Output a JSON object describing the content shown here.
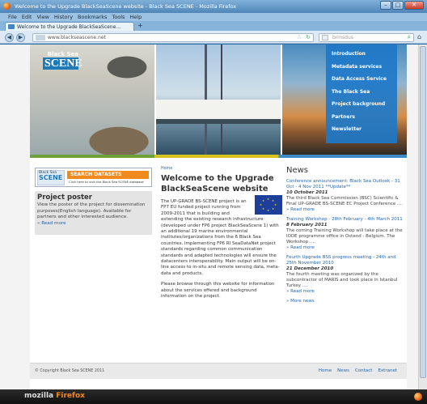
{
  "window": {
    "title": "Welcome to the Upgrade BlackSeaScene website - Black Sea SCENE - Mozilla Firefox",
    "controls": [
      "–",
      "□",
      "✕"
    ]
  },
  "menubar": [
    "File",
    "Edit",
    "View",
    "History",
    "Bookmarks",
    "Tools",
    "Help"
  ],
  "tab": {
    "label": "Welcome to the Upgrade BlackSeaScene...",
    "new_tab": "+"
  },
  "navbar": {
    "url": "www.blackseascene.net",
    "search_placeholder": "brmsdus"
  },
  "site": {
    "logo_top": "Black Sea",
    "logo_main": "SCENE",
    "menu": [
      "Introduction",
      "Metadata services",
      "Data Access Service",
      "The Black Sea",
      "Project background",
      "Partners",
      "Newsletter"
    ],
    "search_datasets": {
      "logo_top": "Black Sea",
      "logo_main": "SCENE",
      "button": "SEARCH DATASETS",
      "sub": "Click here to visit the Black Sea SCENE database"
    },
    "poster": {
      "title": "Project poster",
      "text": "View the poster of the project for dissemination purposes(English language). Available for partners and other interested audience.",
      "more": "» Read more"
    },
    "breadcrumb": "Home",
    "heading": "Welcome to the Upgrade BlackSeaScene website",
    "intro": "The UP-GRADE BS-SCENE project is an FP7 EU funded project running from 2009-2011 that is building and extending the existing research infrastructure (developed under FP6 project BlackSeaScene 1) with an additional 19 marine environmental institutes/organizations from the 6 Black Sea countries. Implementing FP6 RI SeaDataNet project standards regarding common communication standards and adapted technologies will ensure the datacenters interoperability. Main output will be on-line access to in-situ and remote sensing data, meta-data and products.",
    "browse": "Please browse through this website for information about the services offered and background information on the project.",
    "news_title": "News",
    "news": [
      {
        "title": "Conference announcement: Black Sea Outlook - 31 Oct - 4 Nov 2011 **Update**",
        "date": "10 October 2011",
        "body": "The third Black Sea Commission (BSC) Scientific & Final UP-GRADE BS-SCENE EC Project Conference ....",
        "more": "» Read more"
      },
      {
        "title": "Training Workshop - 28th February - 4th March 2011",
        "date": "8 February 2011",
        "body": "The coming Training Workshop will take place at the IODE programme office in Ostend - Belgium. The Workshop ....",
        "more": "» Read more"
      },
      {
        "title": "Fourth Upgrade BSS progress meeting - 24th and 25th November 2010",
        "date": "21 December 2010",
        "body": "The fourth meeting was organized by the subcontractor of MARIS and took place in Istanbul Turkey ....",
        "more": "» Read more"
      }
    ],
    "more_news": "» More news",
    "footer": {
      "copyright": "© Copyright Black Sea SCENE 2011",
      "links": [
        "Home",
        "News",
        "Contact",
        "Extranet"
      ]
    }
  },
  "taskbar": {
    "brand_a": "mozilla ",
    "brand_b": "Firefox"
  }
}
